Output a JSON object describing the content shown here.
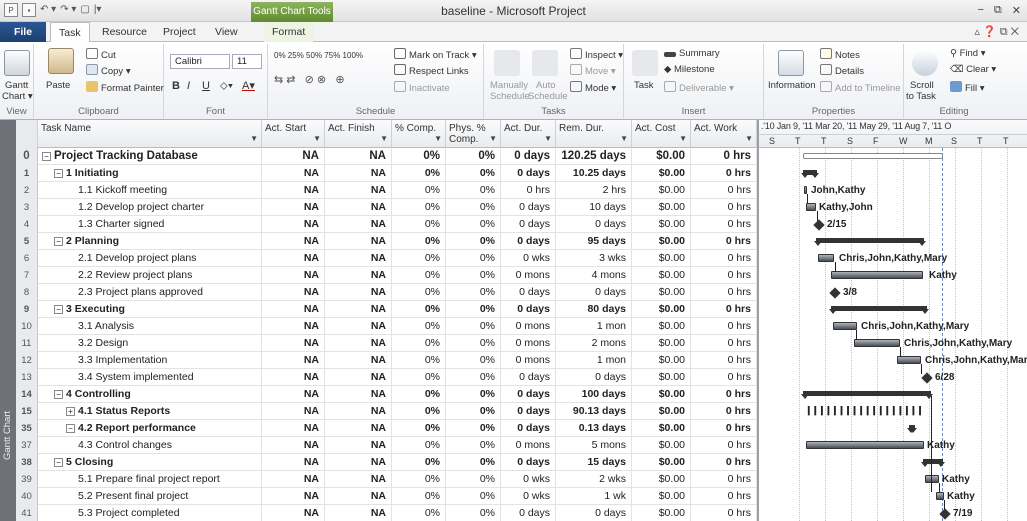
{
  "window": {
    "title": "baseline - Microsoft Project",
    "tools_tab": "Gantt Chart Tools",
    "qat_icons": [
      "project-icon",
      "save-icon",
      "undo-icon",
      "redo-icon",
      "new-icon",
      "customize-icon"
    ],
    "controls": {
      "minimize": "−",
      "restore": "⧉",
      "close": "✕"
    }
  },
  "tabs": [
    {
      "label": "File"
    },
    {
      "label": "Task"
    },
    {
      "label": "Resource"
    },
    {
      "label": "Project"
    },
    {
      "label": "View"
    },
    {
      "label": "Format"
    }
  ],
  "ribbon": {
    "view": {
      "gantt": "Gantt",
      "gantt2": "Chart ▾",
      "label": "View"
    },
    "clipboard": {
      "paste": "Paste",
      "cut": "Cut",
      "copy": "Copy ▾",
      "format_painter": "Format Painter",
      "label": "Clipboard"
    },
    "font": {
      "name": "Calibri",
      "size": "11",
      "bold": "B",
      "italic": "I",
      "underline": "U",
      "label": "Font"
    },
    "schedule": {
      "mark_on_track": "Mark on Track ▾",
      "respect_links": "Respect Links",
      "inactivate": "Inactivate",
      "pct": [
        "0%",
        "25%",
        "50%",
        "75%",
        "100%"
      ],
      "label": "Schedule"
    },
    "tasks": {
      "manually": "Manually",
      "schedule1": "Schedule",
      "auto": "Auto",
      "schedule2": "Schedule",
      "inspect": "Inspect ▾",
      "move": "Move ▾",
      "mode": "Mode ▾",
      "label": "Tasks"
    },
    "insert": {
      "task": "Task",
      "summary": "Summary",
      "milestone": "Milestone",
      "deliverable": "Deliverable ▾",
      "label": "Insert"
    },
    "properties": {
      "information": "Information",
      "notes": "Notes",
      "details": "Details",
      "add_to_timeline": "Add to Timeline",
      "label": "Properties"
    },
    "editing": {
      "scroll": "Scroll",
      "to_task": "to Task",
      "find": "Find ▾",
      "clear": "Clear ▾",
      "fill": "Fill ▾",
      "label": "Editing"
    }
  },
  "sidebar_label": "Gantt Chart",
  "columns": [
    {
      "label": "Task Name"
    },
    {
      "label": "Act. Start"
    },
    {
      "label": "Act. Finish"
    },
    {
      "label": "% Comp."
    },
    {
      "label": "Phys. % Comp."
    },
    {
      "label": "Act. Dur."
    },
    {
      "label": "Rem. Dur."
    },
    {
      "label": "Act. Cost"
    },
    {
      "label": "Act. Work"
    }
  ],
  "rows": [
    {
      "id": "0",
      "name": "Project Tracking Database",
      "level": 0,
      "toggle": "−",
      "summary": true,
      "start": "NA",
      "finish": "NA",
      "pct": "0%",
      "phys": "0%",
      "adur": "0 days",
      "rdur": "120.25 days",
      "cost": "$0.00",
      "work": "0 hrs"
    },
    {
      "id": "1",
      "name": "1 Initiating",
      "level": 1,
      "toggle": "−",
      "summary": true,
      "start": "NA",
      "finish": "NA",
      "pct": "0%",
      "phys": "0%",
      "adur": "0 days",
      "rdur": "10.25 days",
      "cost": "$0.00",
      "work": "0 hrs"
    },
    {
      "id": "2",
      "name": "1.1 Kickoff meeting",
      "level": 2,
      "toggle": "",
      "summary": false,
      "start": "NA",
      "finish": "NA",
      "pct": "0%",
      "phys": "0%",
      "adur": "0 hrs",
      "rdur": "2 hrs",
      "cost": "$0.00",
      "work": "0 hrs"
    },
    {
      "id": "3",
      "name": "1.2 Develop project charter",
      "level": 2,
      "toggle": "",
      "summary": false,
      "start": "NA",
      "finish": "NA",
      "pct": "0%",
      "phys": "0%",
      "adur": "0 days",
      "rdur": "10 days",
      "cost": "$0.00",
      "work": "0 hrs"
    },
    {
      "id": "4",
      "name": "1.3 Charter signed",
      "level": 2,
      "toggle": "",
      "summary": false,
      "start": "NA",
      "finish": "NA",
      "pct": "0%",
      "phys": "0%",
      "adur": "0 days",
      "rdur": "0 days",
      "cost": "$0.00",
      "work": "0 hrs"
    },
    {
      "id": "5",
      "name": "2 Planning",
      "level": 1,
      "toggle": "−",
      "summary": true,
      "start": "NA",
      "finish": "NA",
      "pct": "0%",
      "phys": "0%",
      "adur": "0 days",
      "rdur": "95 days",
      "cost": "$0.00",
      "work": "0 hrs"
    },
    {
      "id": "6",
      "name": "2.1 Develop project plans",
      "level": 2,
      "toggle": "",
      "summary": false,
      "start": "NA",
      "finish": "NA",
      "pct": "0%",
      "phys": "0%",
      "adur": "0 wks",
      "rdur": "3 wks",
      "cost": "$0.00",
      "work": "0 hrs"
    },
    {
      "id": "7",
      "name": "2.2 Review project plans",
      "level": 2,
      "toggle": "",
      "summary": false,
      "start": "NA",
      "finish": "NA",
      "pct": "0%",
      "phys": "0%",
      "adur": "0 mons",
      "rdur": "4 mons",
      "cost": "$0.00",
      "work": "0 hrs"
    },
    {
      "id": "8",
      "name": "2.3 Project plans approved",
      "level": 2,
      "toggle": "",
      "summary": false,
      "start": "NA",
      "finish": "NA",
      "pct": "0%",
      "phys": "0%",
      "adur": "0 days",
      "rdur": "0 days",
      "cost": "$0.00",
      "work": "0 hrs"
    },
    {
      "id": "9",
      "name": "3 Executing",
      "level": 1,
      "toggle": "−",
      "summary": true,
      "start": "NA",
      "finish": "NA",
      "pct": "0%",
      "phys": "0%",
      "adur": "0 days",
      "rdur": "80 days",
      "cost": "$0.00",
      "work": "0 hrs"
    },
    {
      "id": "10",
      "name": "3.1 Analysis",
      "level": 2,
      "toggle": "",
      "summary": false,
      "start": "NA",
      "finish": "NA",
      "pct": "0%",
      "phys": "0%",
      "adur": "0 mons",
      "rdur": "1 mon",
      "cost": "$0.00",
      "work": "0 hrs"
    },
    {
      "id": "11",
      "name": "3.2 Design",
      "level": 2,
      "toggle": "",
      "summary": false,
      "start": "NA",
      "finish": "NA",
      "pct": "0%",
      "phys": "0%",
      "adur": "0 mons",
      "rdur": "2 mons",
      "cost": "$0.00",
      "work": "0 hrs"
    },
    {
      "id": "12",
      "name": "3.3 Implementation",
      "level": 2,
      "toggle": "",
      "summary": false,
      "start": "NA",
      "finish": "NA",
      "pct": "0%",
      "phys": "0%",
      "adur": "0 mons",
      "rdur": "1 mon",
      "cost": "$0.00",
      "work": "0 hrs"
    },
    {
      "id": "13",
      "name": "3.4 System implemented",
      "level": 2,
      "toggle": "",
      "summary": false,
      "start": "NA",
      "finish": "NA",
      "pct": "0%",
      "phys": "0%",
      "adur": "0 days",
      "rdur": "0 days",
      "cost": "$0.00",
      "work": "0 hrs"
    },
    {
      "id": "14",
      "name": "4 Controlling",
      "level": 1,
      "toggle": "−",
      "summary": true,
      "start": "NA",
      "finish": "NA",
      "pct": "0%",
      "phys": "0%",
      "adur": "0 days",
      "rdur": "100 days",
      "cost": "$0.00",
      "work": "0 hrs"
    },
    {
      "id": "15",
      "name": "4.1 Status Reports",
      "level": 2,
      "toggle": "+",
      "summary": true,
      "start": "NA",
      "finish": "NA",
      "pct": "0%",
      "phys": "0%",
      "adur": "0 days",
      "rdur": "90.13 days",
      "cost": "$0.00",
      "work": "0 hrs"
    },
    {
      "id": "35",
      "name": "4.2 Report performance",
      "level": 2,
      "toggle": "−",
      "summary": true,
      "start": "NA",
      "finish": "NA",
      "pct": "0%",
      "phys": "0%",
      "adur": "0 days",
      "rdur": "0.13 days",
      "cost": "$0.00",
      "work": "0 hrs"
    },
    {
      "id": "37",
      "name": "4.3 Control changes",
      "level": 2,
      "toggle": "",
      "summary": false,
      "start": "NA",
      "finish": "NA",
      "pct": "0%",
      "phys": "0%",
      "adur": "0 mons",
      "rdur": "5 mons",
      "cost": "$0.00",
      "work": "0 hrs"
    },
    {
      "id": "38",
      "name": "5 Closing",
      "level": 1,
      "toggle": "−",
      "summary": true,
      "start": "NA",
      "finish": "NA",
      "pct": "0%",
      "phys": "0%",
      "adur": "0 days",
      "rdur": "15 days",
      "cost": "$0.00",
      "work": "0 hrs"
    },
    {
      "id": "39",
      "name": "5.1 Prepare final project report",
      "level": 2,
      "toggle": "",
      "summary": false,
      "start": "NA",
      "finish": "NA",
      "pct": "0%",
      "phys": "0%",
      "adur": "0 wks",
      "rdur": "2 wks",
      "cost": "$0.00",
      "work": "0 hrs"
    },
    {
      "id": "40",
      "name": "5.2 Present final project",
      "level": 2,
      "toggle": "",
      "summary": false,
      "start": "NA",
      "finish": "NA",
      "pct": "0%",
      "phys": "0%",
      "adur": "0 wks",
      "rdur": "1 wk",
      "cost": "$0.00",
      "work": "0 hrs"
    },
    {
      "id": "41",
      "name": "5.3 Project completed",
      "level": 2,
      "toggle": "",
      "summary": false,
      "start": "NA",
      "finish": "NA",
      "pct": "0%",
      "phys": "0%",
      "adur": "0 days",
      "rdur": "0 days",
      "cost": "$0.00",
      "work": "0 hrs"
    }
  ],
  "timescale": {
    "top": ".'10  Jan 9, '11    Mar 20, '11  May 29, '11  Aug 7, '11  O",
    "bottom": [
      "S",
      "T",
      "T",
      "S",
      "F",
      "W",
      "M",
      "S",
      "T",
      "T"
    ]
  },
  "gantt_labels": {
    "r2": "John,Kathy",
    "r3": "Kathy,John",
    "r4": "2/15",
    "r6": "Chris,John,Kathy,Mary",
    "r7": "Kathy",
    "r8": "3/8",
    "r10": "Chris,John,Kathy,Mary",
    "r11": "Chris,John,Kathy,Mary",
    "r12": "Chris,John,Kathy,Mary",
    "r13": "6/28",
    "r37": "Kathy",
    "r39": "Kathy",
    "r40": "Kathy",
    "r41": "7/19"
  },
  "status_marks": "❙❙❙❙❙❙❙❙❙❙❙❙❙❙❙❙❙❙"
}
